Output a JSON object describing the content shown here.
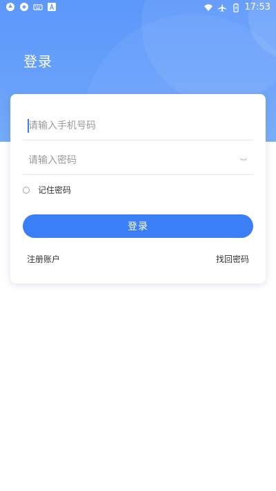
{
  "status_bar": {
    "time": "17:53",
    "left_icons": [
      "app-icon-1",
      "app-icon-2",
      "keyboard-icon",
      "text-a-icon"
    ],
    "right_icons": [
      "wifi-icon",
      "airplane-icon",
      "battery-icon"
    ]
  },
  "header": {
    "title": "登录",
    "gradient_colors": [
      "#5c97fb",
      "#74aaf9"
    ]
  },
  "form": {
    "phone_placeholder": "请输入手机号码",
    "phone_value": "",
    "password_placeholder": "请输入密码",
    "password_value": "",
    "remember_label": "记住密码",
    "remember_checked": false,
    "submit_label": "登录",
    "register_label": "注册账户",
    "forgot_label": "找回密码"
  },
  "colors": {
    "accent": "#3b7ff6",
    "background": "#ffffff"
  }
}
